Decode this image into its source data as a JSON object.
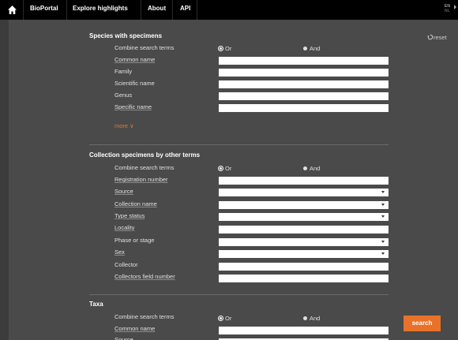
{
  "nav": {
    "items": [
      "BioPortal",
      "Explore highlights",
      "About",
      "API"
    ],
    "lang_en": "EN",
    "lang_nl": "NL"
  },
  "reset_label": "reset",
  "search_label": "search",
  "colors": {
    "accent": "#e8722a",
    "topbar": "#000000",
    "background": "#4a4a4a"
  },
  "section_species": {
    "title": "Species with specimens",
    "combine_label": "Combine search terms",
    "or_label": "Or",
    "and_label": "And",
    "fields": [
      "Common name",
      "Family",
      "Scientific name",
      "Genus",
      "Specific name"
    ],
    "more_label": "more ∨"
  },
  "section_collection": {
    "title": "Collection specimens by other terms",
    "combine_label": "Combine search terms",
    "or_label": "Or",
    "and_label": "And",
    "fields": [
      "Registration number",
      "Source",
      "Collection name",
      "Type status",
      "Locality",
      "Phase or stage",
      "Sex",
      "Collector",
      "Collectors field number"
    ]
  },
  "section_taxa": {
    "title": "Taxa",
    "combine_label": "Combine search terms",
    "or_label": "Or",
    "and_label": "And",
    "fields": [
      "Common name",
      "Source"
    ]
  }
}
